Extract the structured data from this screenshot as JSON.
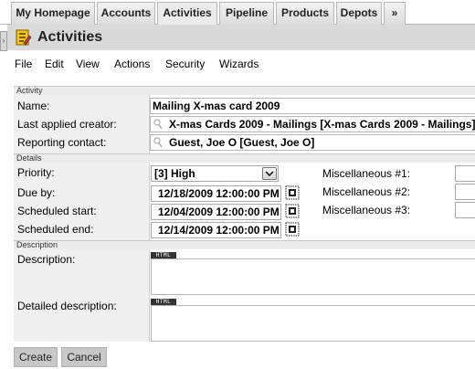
{
  "tabs": [
    {
      "label": "My Homepage"
    },
    {
      "label": "Accounts"
    },
    {
      "label": "Activities"
    },
    {
      "label": "Pipeline"
    },
    {
      "label": "Products"
    },
    {
      "label": "Depots"
    },
    {
      "label": "»"
    }
  ],
  "active_tab": "Activities",
  "header": {
    "title": "Activities",
    "icon": "activities-icon"
  },
  "menu": [
    "File",
    "Edit",
    "View",
    "Actions",
    "Security",
    "Wizards"
  ],
  "sections": {
    "activity": "Activity",
    "details": "Details",
    "description": "Description"
  },
  "fields": {
    "name": {
      "label": "Name:",
      "value": "Mailing X-mas card 2009"
    },
    "creator": {
      "label": "Last applied creator:",
      "value": "X-mas Cards 2009 - Mailings [X-mas Cards 2009 - Mailings]"
    },
    "reporting_contact": {
      "label": "Reporting contact:",
      "value": "Guest, Joe O [Guest, Joe O]"
    },
    "priority": {
      "label": "Priority:",
      "value": "[3] High"
    },
    "due_by": {
      "label": "Due by:",
      "value": "12/18/2009 12:00:00 PM"
    },
    "scheduled_start": {
      "label": "Scheduled start:",
      "value": "12/04/2009 12:00:00 PM"
    },
    "scheduled_end": {
      "label": "Scheduled end:",
      "value": "12/14/2009 12:00:00 PM"
    },
    "misc1": {
      "label": "Miscellaneous #1:",
      "value": ""
    },
    "misc2": {
      "label": "Miscellaneous #2:",
      "value": ""
    },
    "misc3": {
      "label": "Miscellaneous #3:",
      "value": ""
    },
    "description": {
      "label": "Description:",
      "value": ""
    },
    "detailed_description": {
      "label": "Detailed description:",
      "value": ""
    }
  },
  "html_badge": "HTML",
  "buttons": {
    "create": "Create",
    "cancel": "Cancel"
  },
  "colors": {
    "header_bg": "#d9d9d9",
    "label_bg": "#f0f0f0",
    "button_bg": "#c8c8c8"
  }
}
